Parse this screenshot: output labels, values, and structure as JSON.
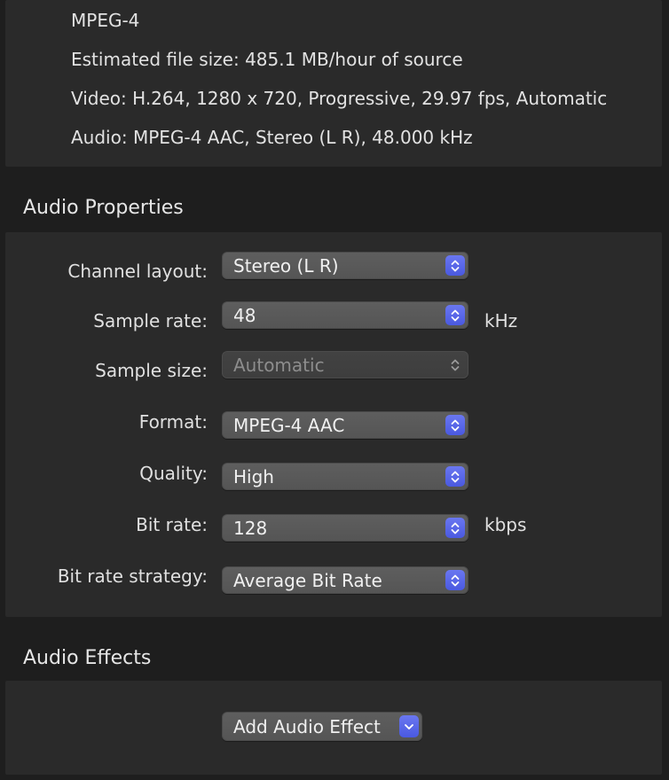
{
  "summary": {
    "format": "MPEG-4",
    "file_size": "Estimated file size: 485.1 MB/hour of source",
    "video": "Video: H.264, 1280 x 720, Progressive, 29.97 fps, Automatic",
    "audio": "Audio: MPEG-4 AAC, Stereo (L R), 48.000 kHz"
  },
  "audio_properties": {
    "header": "Audio Properties",
    "channel_layout": {
      "label": "Channel layout:",
      "value": "Stereo (L R)"
    },
    "sample_rate": {
      "label": "Sample rate:",
      "value": "48",
      "unit": "kHz"
    },
    "sample_size": {
      "label": "Sample size:",
      "value": "Automatic"
    },
    "format": {
      "label": "Format:",
      "value": "MPEG-4 AAC"
    },
    "quality": {
      "label": "Quality:",
      "value": "High"
    },
    "bit_rate": {
      "label": "Bit rate:",
      "value": "128",
      "unit": "kbps"
    },
    "bit_rate_strategy": {
      "label": "Bit rate strategy:",
      "value": "Average Bit Rate"
    }
  },
  "audio_effects": {
    "header": "Audio Effects",
    "add_button_label": "Add Audio Effect"
  },
  "colors": {
    "background": "#1e1e1e",
    "panel": "#2a2a2a",
    "accent": "#5a67e8"
  },
  "icons": {
    "popup_stepper": "up-down-chevron-icon",
    "dropdown": "chevron-down-icon"
  }
}
